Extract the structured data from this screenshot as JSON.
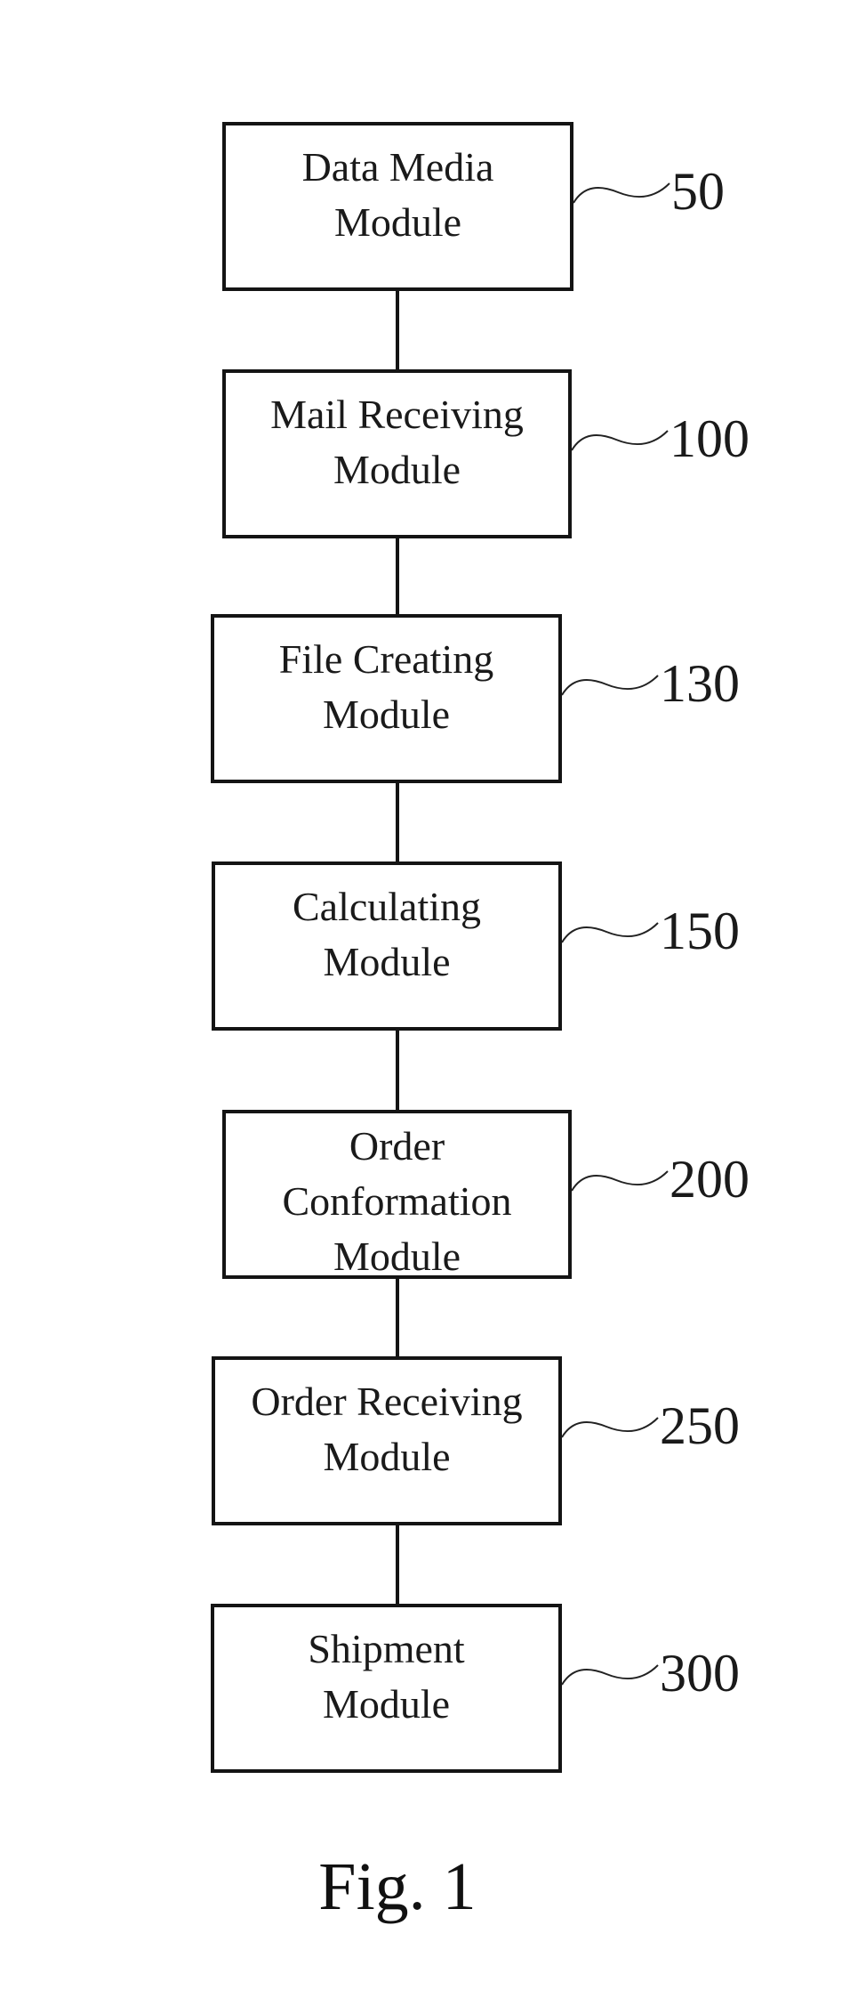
{
  "figure": {
    "caption": "Fig. 1",
    "modules": [
      {
        "id": "data-media",
        "lines": [
          "Data Media",
          "Module"
        ],
        "ref": "50"
      },
      {
        "id": "mail-receiving",
        "lines": [
          "Mail Receiving",
          "Module"
        ],
        "ref": "100"
      },
      {
        "id": "file-creating",
        "lines": [
          "File Creating",
          "Module"
        ],
        "ref": "130"
      },
      {
        "id": "calculating",
        "lines": [
          "Calculating",
          "Module"
        ],
        "ref": "150"
      },
      {
        "id": "order-conformation",
        "lines": [
          "Order",
          "Conformation",
          "Module"
        ],
        "ref": "200"
      },
      {
        "id": "order-receiving",
        "lines": [
          "Order Receiving",
          "Module"
        ],
        "ref": "250"
      },
      {
        "id": "shipment",
        "lines": [
          "Shipment",
          "Module"
        ],
        "ref": "300"
      }
    ]
  }
}
